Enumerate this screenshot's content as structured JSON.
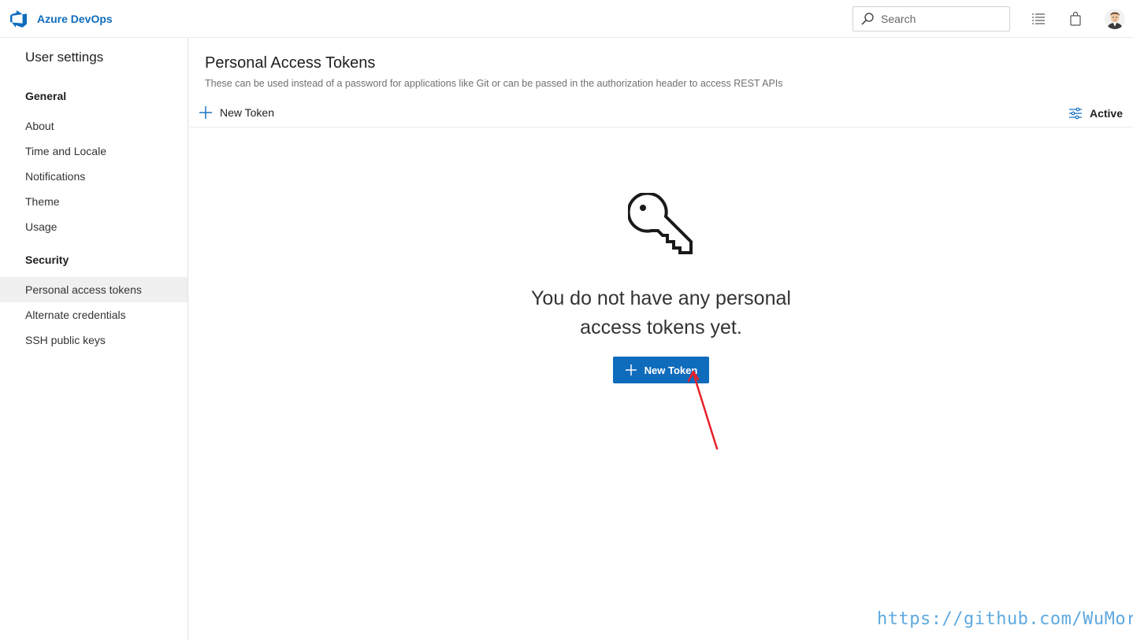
{
  "app": {
    "brand_name": "Azure DevOps",
    "accent_color": "#0f6cbd"
  },
  "header": {
    "search": {
      "placeholder": "Search",
      "value": ""
    },
    "icons": [
      "search-icon",
      "checklist-icon",
      "shopping-bag-icon",
      "user-avatar"
    ]
  },
  "sidebar": {
    "title": "User settings",
    "sections": [
      {
        "heading": "General",
        "items": [
          {
            "label": "About"
          },
          {
            "label": "Time and Locale"
          },
          {
            "label": "Notifications"
          },
          {
            "label": "Theme"
          },
          {
            "label": "Usage"
          }
        ]
      },
      {
        "heading": "Security",
        "items": [
          {
            "label": "Personal access tokens",
            "selected": true
          },
          {
            "label": "Alternate credentials"
          },
          {
            "label": "SSH public keys"
          }
        ]
      }
    ]
  },
  "main": {
    "title": "Personal Access Tokens",
    "description": "These can be used instead of a password for applications like Git or can be passed in the authorization header to access REST APIs",
    "command_bar": {
      "new_token_label": "New Token",
      "filter_label": "Active"
    },
    "empty_state": {
      "icon": "key-icon",
      "message_line1": "You do not have any personal",
      "message_line2": "access tokens yet.",
      "button_label": "New Token"
    }
  },
  "watermark": {
    "text": "https://github.com/WuMortal",
    "color": "#5fa9df"
  },
  "annotation": {
    "arrow_color": "#e8202a"
  }
}
